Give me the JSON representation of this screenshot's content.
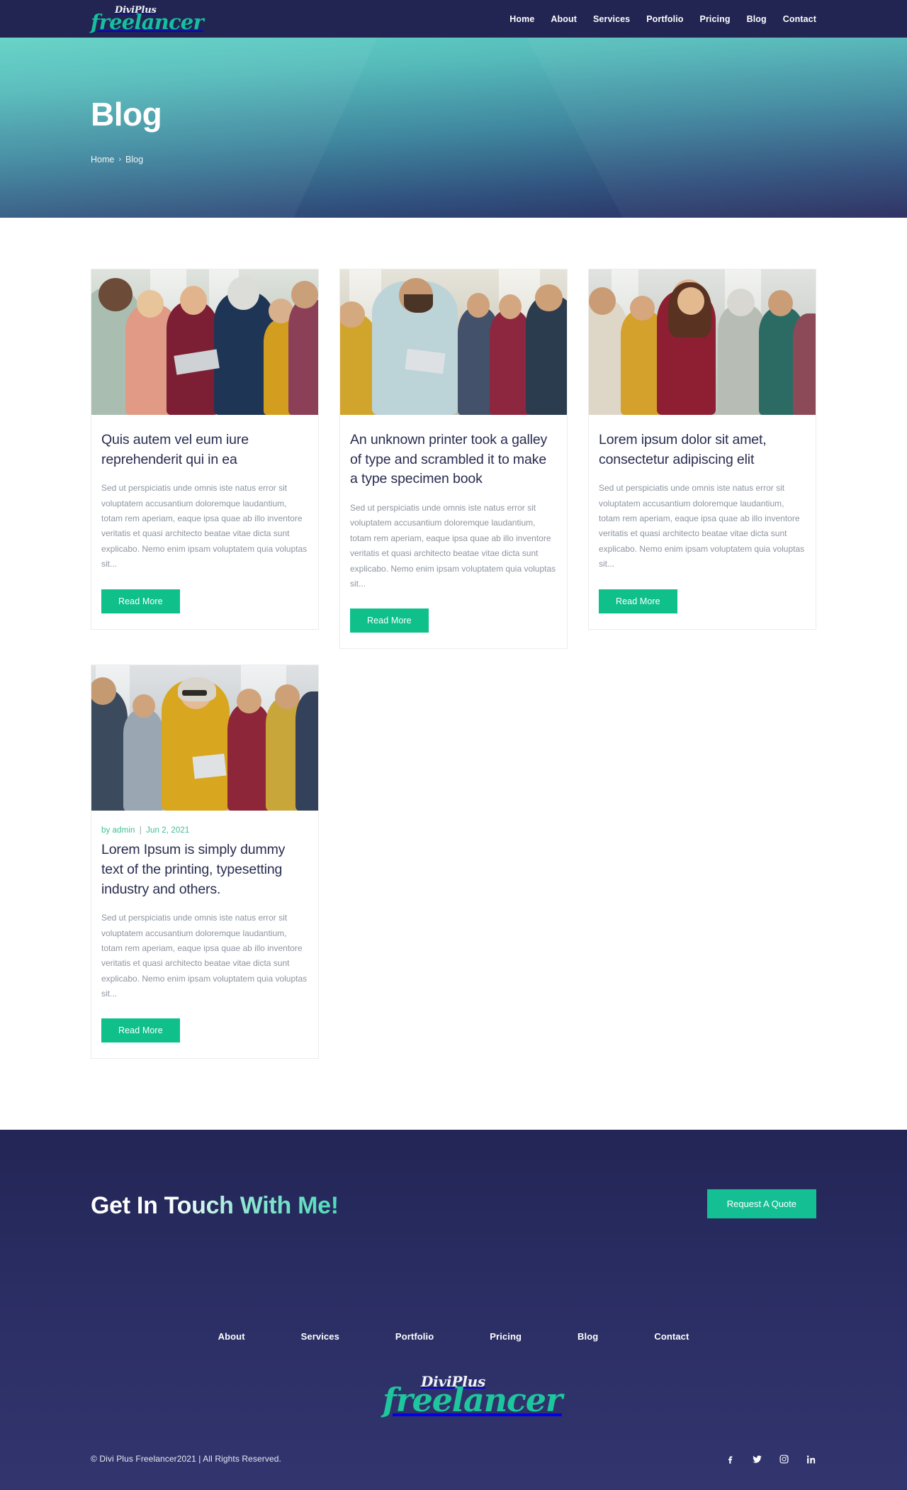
{
  "header": {
    "logo": {
      "top": "DiviPlus",
      "main": "freelancer"
    },
    "nav": [
      {
        "label": "Home"
      },
      {
        "label": "About"
      },
      {
        "label": "Services"
      },
      {
        "label": "Portfolio"
      },
      {
        "label": "Pricing"
      },
      {
        "label": "Blog"
      },
      {
        "label": "Contact"
      }
    ]
  },
  "hero": {
    "title": "Blog",
    "breadcrumb": {
      "home": "Home",
      "separator": "›",
      "current": "Blog"
    }
  },
  "blog": {
    "read_more_label": "Read More",
    "posts": [
      {
        "meta": null,
        "title": "Quis autem vel eum iure reprehenderit qui in ea",
        "excerpt": "Sed ut perspiciatis unde omnis iste natus error sit voluptatem accusantium doloremque laudantium, totam rem aperiam, eaque ipsa quae ab illo inventore veritatis et quasi architecto beatae vitae dicta sunt explicabo. Nemo enim ipsam voluptatem quia voluptas sit...",
        "read_more": "Read More",
        "image_alt": "group-of-colleagues-with-tablet"
      },
      {
        "meta": null,
        "title": "An unknown printer took a galley of type and scrambled it to make a type specimen book",
        "excerpt": "Sed ut perspiciatis unde omnis iste natus error sit voluptatem accusantium doloremque laudantium, totam rem aperiam, eaque ipsa quae ab illo inventore veritatis et quasi architecto beatae vitae dicta sunt explicabo. Nemo enim ipsam voluptatem quia voluptas sit...",
        "read_more": "Read More",
        "image_alt": "smiling-man-holding-tablet"
      },
      {
        "meta": null,
        "title": "Lorem ipsum dolor sit amet, consectetur adipiscing elit",
        "excerpt": "Sed ut perspiciatis unde omnis iste natus error sit voluptatem accusantium doloremque laudantium, totam rem aperiam, eaque ipsa quae ab illo inventore veritatis et quasi architecto beatae vitae dicta sunt explicabo. Nemo enim ipsam voluptatem quia voluptas sit...",
        "read_more": "Read More",
        "image_alt": "woman-in-red-sweater-with-team"
      },
      {
        "meta": {
          "author_prefix": "by",
          "author": "admin",
          "separator": "|",
          "date": "Jun 2, 2021"
        },
        "title": "Lorem Ipsum is simply dummy text of the printing, typesetting industry and others.",
        "excerpt": "Sed ut perspiciatis unde omnis iste natus error sit voluptatem accusantium doloremque laudantium, totam rem aperiam, eaque ipsa quae ab illo inventore veritatis et quasi architecto beatae vitae dicta sunt explicabo. Nemo enim ipsam voluptatem quia voluptas sit...",
        "read_more": "Read More",
        "image_alt": "woman-in-yellow-sweater-with-glasses"
      }
    ]
  },
  "cta": {
    "title": "Get In Touch With Me!",
    "button_label": "Request A Quote"
  },
  "footer": {
    "nav": [
      {
        "label": "About"
      },
      {
        "label": "Services"
      },
      {
        "label": "Portfolio"
      },
      {
        "label": "Pricing"
      },
      {
        "label": "Blog"
      },
      {
        "label": "Contact"
      }
    ],
    "logo": {
      "top": "DiviPlus",
      "main": "freelancer"
    },
    "copyright": "© Divi Plus Freelancer2021 | All Rights Reserved.",
    "socials": [
      {
        "name": "facebook"
      },
      {
        "name": "twitter"
      },
      {
        "name": "instagram"
      },
      {
        "name": "linkedin"
      }
    ]
  },
  "colors": {
    "navy": "#222452",
    "teal": "#16bfa0",
    "green_button": "#0fc08b",
    "hero_top": "#62d2c5",
    "hero_bottom": "#2a2c5f",
    "meta_green": "#3fbf8f",
    "title_ink": "#292d50",
    "body_gray": "#8e94a0"
  }
}
